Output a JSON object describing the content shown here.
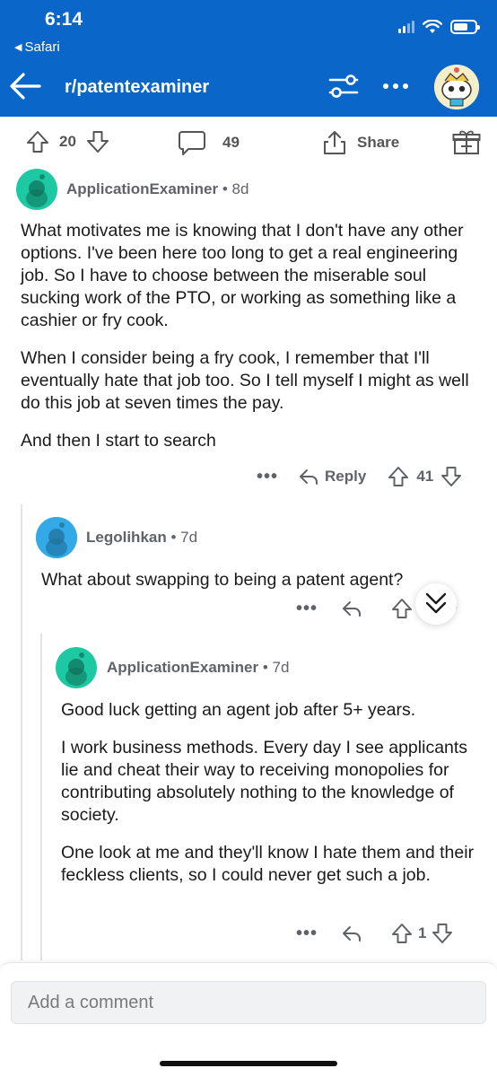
{
  "status_bar": {
    "time": "6:14",
    "back_app": "Safari"
  },
  "header": {
    "subreddit": "r/patentexaminer"
  },
  "post_bar": {
    "upvotes": "20",
    "comments": "49",
    "share_label": "Share"
  },
  "comments": [
    {
      "username": "ApplicationExaminer",
      "age": "8d",
      "paragraphs": [
        "What motivates me is knowing that I don't have any other options. I've been here too long to get a real engineering job. So I have to choose between the miserable soul sucking work of the PTO, or working as something like a cashier or fry cook.",
        "When I consider being a fry cook, I remember that I'll eventually hate that job too. So I tell myself I might as well do this job at seven times the pay.",
        "And then I start to search"
      ],
      "reply_label": "Reply",
      "votes": "41"
    },
    {
      "username": "Legolihkan",
      "age": "7d",
      "paragraphs": [
        "What about swapping to being a patent agent?"
      ],
      "votes": ""
    },
    {
      "username": "ApplicationExaminer",
      "age": "7d",
      "paragraphs": [
        "Good luck getting an agent job after 5+ years.",
        "I work business methods. Every day I see applicants lie and cheat their way to receiving monopolies for contributing absolutely nothing to the knowledge of society.",
        "One look at me and they'll know I hate them and their feckless clients, so I could never get such a job."
      ],
      "votes": "1"
    }
  ],
  "comment_box": {
    "placeholder": "Add a comment"
  },
  "colors": {
    "header_blue": "#0a66c8",
    "avatar_teal": "#1dc9a3"
  }
}
